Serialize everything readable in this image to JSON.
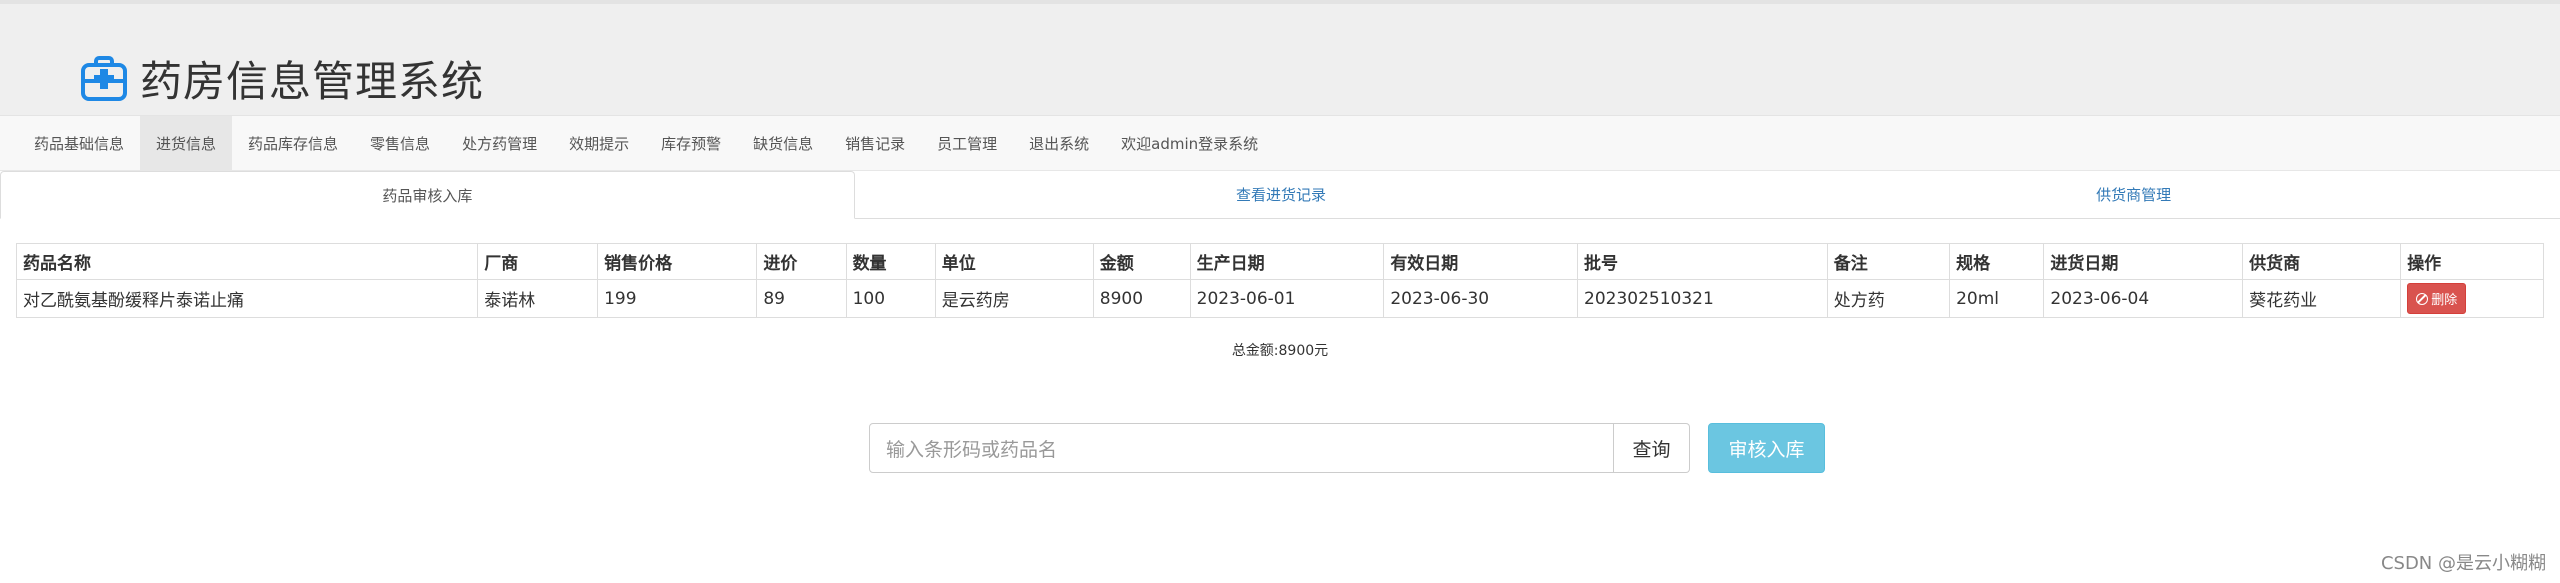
{
  "app": {
    "title": "药房信息管理系统"
  },
  "nav": {
    "items": [
      {
        "label": "药品基础信息",
        "active": false
      },
      {
        "label": "进货信息",
        "active": true
      },
      {
        "label": "药品库存信息",
        "active": false
      },
      {
        "label": "零售信息",
        "active": false
      },
      {
        "label": "处方药管理",
        "active": false
      },
      {
        "label": "效期提示",
        "active": false
      },
      {
        "label": "库存预警",
        "active": false
      },
      {
        "label": "缺货信息",
        "active": false
      },
      {
        "label": "销售记录",
        "active": false
      },
      {
        "label": "员工管理",
        "active": false
      },
      {
        "label": "退出系统",
        "active": false
      },
      {
        "label": "欢迎admin登录系统",
        "active": false
      }
    ]
  },
  "tabs": [
    {
      "label": "药品审核入库",
      "active": true
    },
    {
      "label": "查看进货记录",
      "active": false
    },
    {
      "label": "供货商管理",
      "active": false
    }
  ],
  "table": {
    "headers": [
      "药品名称",
      "厂商",
      "销售价格",
      "进价",
      "数量",
      "单位",
      "金额",
      "生产日期",
      "有效日期",
      "批号",
      "备注",
      "规格",
      "进货日期",
      "供货商",
      "操作"
    ],
    "rows": [
      [
        "对乙酰氨基酚缓释片泰诺止痛",
        "泰诺林",
        "199",
        "89",
        "100",
        "是云药房",
        "8900",
        "2023-06-01",
        "2023-06-30",
        "202302510321",
        "处方药",
        "20ml",
        "2023-06-04",
        "葵花药业"
      ]
    ],
    "delete_label": "删除"
  },
  "total": {
    "text": "总金额:8900元"
  },
  "search": {
    "placeholder": "输入条形码或药品名",
    "button_label": "查询",
    "audit_label": "审核入库"
  },
  "watermark": "CSDN @是云小糊糊",
  "colors": {
    "danger": "#d9534f",
    "info": "#5bc0de",
    "link": "#337ab7",
    "brand_icon": "#1e88e5"
  }
}
